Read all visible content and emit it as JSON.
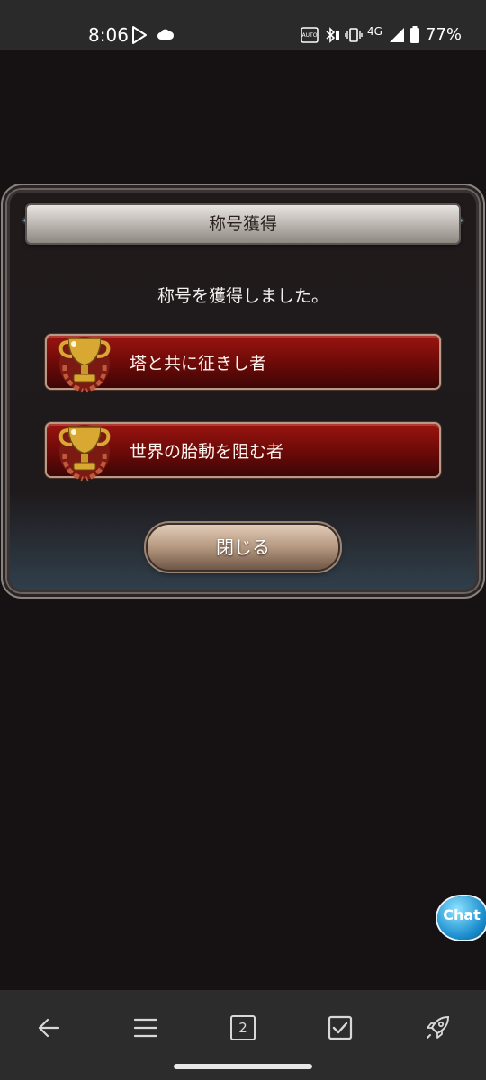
{
  "status_bar": {
    "time": "8:06",
    "network": "4G",
    "battery": "77%"
  },
  "dialog": {
    "title": "称号獲得",
    "message": "称号を獲得しました。",
    "titles": [
      {
        "label": "塔と共に征きし者"
      },
      {
        "label": "世界の胎動を阻む者"
      }
    ],
    "close_label": "閉じる"
  },
  "chat": {
    "label": "Chat"
  },
  "nav": {
    "tab_count": "2"
  },
  "colors": {
    "title_row": "#6a0a08",
    "accent_gem": "#7fc7de",
    "button": "#b59880"
  }
}
